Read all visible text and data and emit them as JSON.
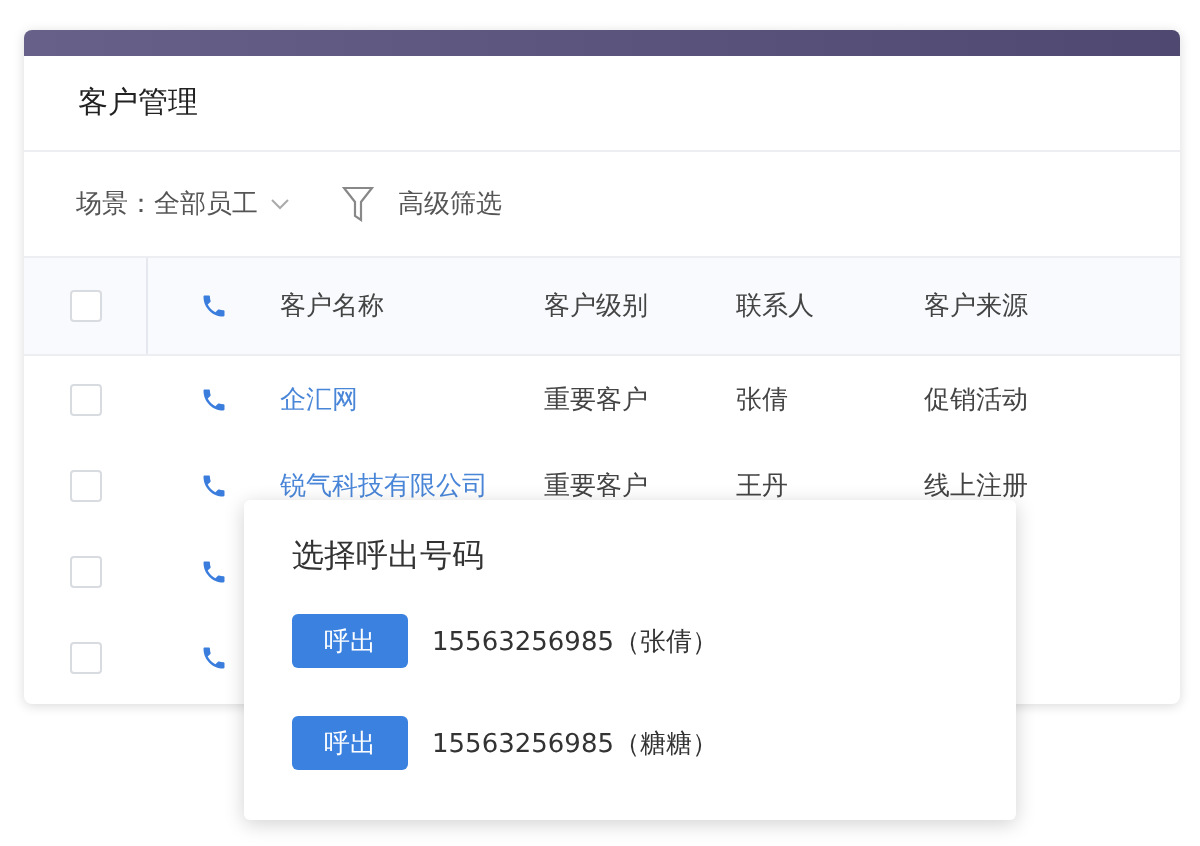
{
  "title": "客户管理",
  "filter": {
    "scene_label": "场景：",
    "scene_value": "全部员工",
    "advanced": "高级筛选"
  },
  "table": {
    "header_checked": false,
    "columns": [
      "客户名称",
      "客户级别",
      "联系人",
      "客户来源"
    ],
    "rows": [
      {
        "checked": false,
        "cells": [
          "企汇网",
          "重要客户",
          "张倩",
          "促销活动"
        ]
      },
      {
        "checked": false,
        "cells": [
          "锐气科技有限公司",
          "重要客户",
          "王丹",
          "线上注册"
        ]
      },
      {
        "checked": false
      },
      {
        "checked": false
      }
    ]
  },
  "popup": {
    "title": "选择呼出号码",
    "options": [
      {
        "button": "呼出",
        "number": "15563256985（张倩）"
      },
      {
        "button": "呼出",
        "number": "15563256985（糖糖）"
      }
    ]
  }
}
